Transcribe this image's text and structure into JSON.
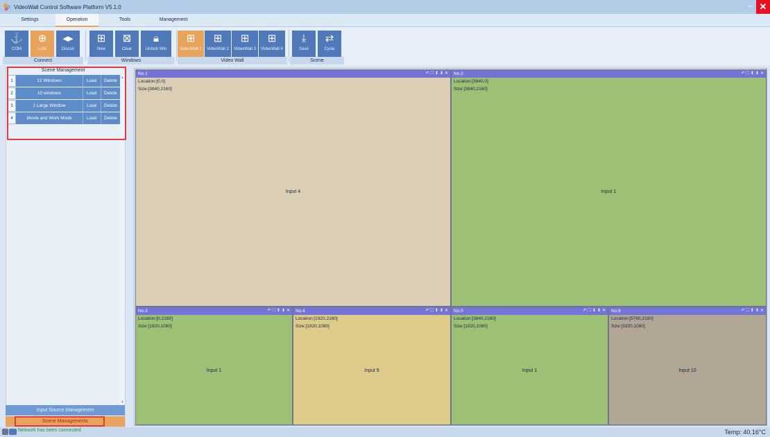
{
  "window": {
    "title": "VideoWall Control Software Platform V5.1.0",
    "minimize_glyph": "−",
    "close_glyph": "✕"
  },
  "menu": {
    "tabs": [
      {
        "label": "Settings",
        "active": false
      },
      {
        "label": "Operation",
        "active": true
      },
      {
        "label": "Tools",
        "active": false
      },
      {
        "label": "Management",
        "active": false
      }
    ]
  },
  "ribbon": {
    "groups": [
      {
        "label": "Connect",
        "buttons": [
          {
            "label": "COM",
            "icon": "anchor-icon",
            "active": false
          },
          {
            "label": "LAN",
            "icon": "globe-icon",
            "active": true
          },
          {
            "label": "Discon",
            "icon": "disconnect-icon",
            "active": false
          }
        ]
      },
      {
        "label": "Windows",
        "buttons": [
          {
            "label": "New",
            "icon": "plus-box-icon",
            "active": false
          },
          {
            "label": "Clear",
            "icon": "x-box-icon",
            "active": false
          },
          {
            "label": "Unlock Win",
            "icon": "lock-icon",
            "active": false
          }
        ]
      },
      {
        "label": "Video Wall",
        "buttons": [
          {
            "label": "VideoWall 1",
            "icon": "grid-icon",
            "active": true
          },
          {
            "label": "VideoWall 2",
            "icon": "grid-icon",
            "active": false
          },
          {
            "label": "VideoWall 3",
            "icon": "grid-icon",
            "active": false
          },
          {
            "label": "VideoWall 4",
            "icon": "grid-icon",
            "active": false
          }
        ]
      },
      {
        "label": "Scene",
        "buttons": [
          {
            "label": "Save",
            "icon": "save-icon",
            "active": false
          },
          {
            "label": "Cycle",
            "icon": "cycle-icon",
            "active": false
          }
        ]
      }
    ]
  },
  "scene_panel": {
    "title": "Scene Management",
    "scenes": [
      {
        "num": "1",
        "name": "12 Windows",
        "load": "Load",
        "delete": "Delete"
      },
      {
        "num": "2",
        "name": "10 windows",
        "load": "Load",
        "delete": "Delete"
      },
      {
        "num": "3",
        "name": "1 Large Window",
        "load": "Load",
        "delete": "Delete"
      },
      {
        "num": "4",
        "name": "Movie and Work Mode",
        "load": "Load",
        "delete": "Delete"
      }
    ],
    "input_source_button": "Input Source Management",
    "scene_managements_button": "Scene Managements"
  },
  "windows": [
    {
      "no": "No.1",
      "location": "Location:[0,0]",
      "size": "Size:[3840,2160]",
      "input": "Input 4",
      "color": "#dccdb5"
    },
    {
      "no": "No.2",
      "location": "Location:[3840,0]",
      "size": "Size:[3840,2160]",
      "input": "Input 1",
      "color": "#9dbf76"
    },
    {
      "no": "No.3",
      "location": "Location:[0,2160]",
      "size": "Size:[1920,1080]",
      "input": "Input 1",
      "color": "#9dbf76"
    },
    {
      "no": "No.4",
      "location": "Location:[1920,2160]",
      "size": "Size:[1920,1080]",
      "input": "Input 9",
      "color": "#decb8a"
    },
    {
      "no": "No.5",
      "location": "Location:[3840,2160]",
      "size": "Size:[1920,1080]",
      "input": "Input 1",
      "color": "#9dbf76"
    },
    {
      "no": "No.6",
      "location": "Location:[5760,2160]",
      "size": "Size:[1920,1080]",
      "input": "Input 10",
      "color": "#b1a593"
    }
  ],
  "window_controls": [
    "↶",
    "⛶",
    "⬆",
    "⬇",
    "✕"
  ],
  "status": {
    "network": "Network has been connected",
    "temp": "Temp: 40.16°C"
  }
}
